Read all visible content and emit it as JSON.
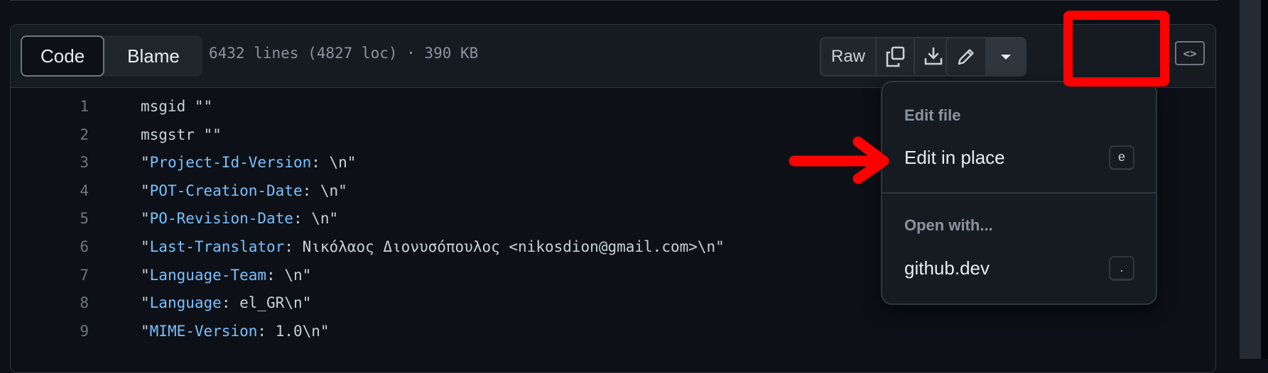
{
  "file_header": {
    "tabs": [
      {
        "label": "Code",
        "active": true
      },
      {
        "label": "Blame",
        "active": false
      }
    ],
    "file_info": "6432 lines (4827 loc) · 390 KB",
    "raw_label": "Raw",
    "icons": {
      "copy": "copy-icon",
      "download": "download-icon",
      "edit": "pencil-icon",
      "more": "triangle-down-icon",
      "symbols": "code-square-icon"
    },
    "symbols_glyph": "<>"
  },
  "code_lines": [
    {
      "num": "1",
      "parts": [
        {
          "t": "msgid \"\"",
          "c": "plain"
        }
      ]
    },
    {
      "num": "2",
      "parts": [
        {
          "t": "msgstr \"\"",
          "c": "plain"
        }
      ]
    },
    {
      "num": "3",
      "parts": [
        {
          "t": "\"",
          "c": "plain"
        },
        {
          "t": "Project-Id-Version",
          "c": "key"
        },
        {
          "t": ": \\n\"",
          "c": "plain"
        }
      ]
    },
    {
      "num": "4",
      "parts": [
        {
          "t": "\"",
          "c": "plain"
        },
        {
          "t": "POT-Creation-Date",
          "c": "key"
        },
        {
          "t": ": \\n\"",
          "c": "plain"
        }
      ]
    },
    {
      "num": "5",
      "parts": [
        {
          "t": "\"",
          "c": "plain"
        },
        {
          "t": "PO-Revision-Date",
          "c": "key"
        },
        {
          "t": ": \\n\"",
          "c": "plain"
        }
      ]
    },
    {
      "num": "6",
      "parts": [
        {
          "t": "\"",
          "c": "plain"
        },
        {
          "t": "Last-Translator",
          "c": "key"
        },
        {
          "t": ": Νικόλαος Διονυσόπουλος <nikosdion@gmail.com>\\n\"",
          "c": "plain"
        }
      ]
    },
    {
      "num": "7",
      "parts": [
        {
          "t": "\"",
          "c": "plain"
        },
        {
          "t": "Language-Team",
          "c": "key"
        },
        {
          "t": ": \\n\"",
          "c": "plain"
        }
      ]
    },
    {
      "num": "8",
      "parts": [
        {
          "t": "\"",
          "c": "plain"
        },
        {
          "t": "Language",
          "c": "key"
        },
        {
          "t": ": el_GR\\n\"",
          "c": "plain"
        }
      ]
    },
    {
      "num": "9",
      "parts": [
        {
          "t": "\"",
          "c": "plain"
        },
        {
          "t": "MIME-Version",
          "c": "key"
        },
        {
          "t": ": 1.0\\n\"",
          "c": "plain"
        }
      ]
    }
  ],
  "edit_menu": {
    "group1_label": "Edit file",
    "item1": {
      "label": "Edit in place",
      "shortcut": "e"
    },
    "group2_label": "Open with...",
    "item2": {
      "label": "github.dev",
      "shortcut": "."
    }
  },
  "annotations": {
    "color": "#ff0000"
  },
  "colors": {
    "background": "#0d1117",
    "header": "#161b22",
    "border": "#30363d",
    "key_text": "#79c0ff",
    "line_number": "#6e7681"
  }
}
